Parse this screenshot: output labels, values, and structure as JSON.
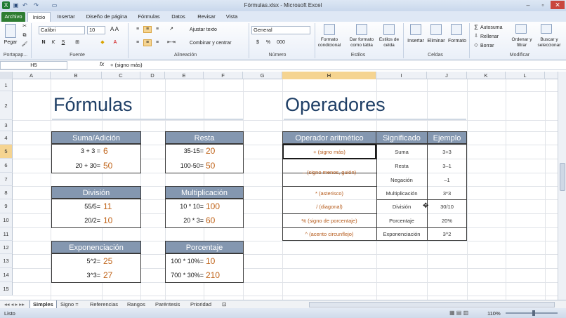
{
  "window": {
    "title": "Fórmulas.xlsx - Microsoft Excel"
  },
  "qat": {
    "save": "save-icon",
    "undo": "undo-icon",
    "redo": "redo-icon"
  },
  "tabs": [
    "Archivo",
    "Inicio",
    "Insertar",
    "Diseño de página",
    "Fórmulas",
    "Datos",
    "Revisar",
    "Vista"
  ],
  "ribbon": {
    "paste": "Pegar",
    "clipboard": "Portapap...",
    "font_name": "Calibri",
    "font_size": "10",
    "bold": "N",
    "italic": "K",
    "underline": "S",
    "font_group": "Fuente",
    "wrap": "Ajustar texto",
    "merge": "Combinar y centrar",
    "align_group": "Alineación",
    "number_format": "General",
    "currency": "$",
    "percent": "%",
    "thousands": "000",
    "number_group": "Número",
    "cond_format": "Formato condicional",
    "table_format": "Dar formato como tabla",
    "cell_styles": "Estilos de celda",
    "styles_group": "Estilos",
    "insert": "Insertar",
    "delete": "Eliminar",
    "format": "Formato",
    "cells_group": "Celdas",
    "autosum": "Autosuma",
    "fill": "Rellenar",
    "clear": "Borrar",
    "sort": "Ordenar y filtrar",
    "find": "Buscar y seleccionar",
    "modify_group": "Modificar"
  },
  "formula_bar": {
    "name_box": "H5",
    "fx": "fx",
    "content": "+ (signo más)"
  },
  "columns": [
    "A",
    "B",
    "C",
    "D",
    "E",
    "F",
    "G",
    "H",
    "I",
    "J",
    "K",
    "L"
  ],
  "rows": [
    "1",
    "2",
    "3",
    "4",
    "5",
    "6",
    "7",
    "8",
    "9",
    "10",
    "11",
    "12",
    "13",
    "14",
    "15"
  ],
  "sheet": {
    "formulas_title": "Fórmulas",
    "operators_title": "Operadores",
    "suma": {
      "header": "Suma/Adición",
      "rows": [
        {
          "label": "3 + 3 =",
          "value": "6"
        },
        {
          "label": "20 + 30=",
          "value": "50"
        }
      ]
    },
    "resta": {
      "header": "Resta",
      "rows": [
        {
          "label": "35-15=",
          "value": "20"
        },
        {
          "label": "100-50=",
          "value": "50"
        }
      ]
    },
    "division": {
      "header": "División",
      "rows": [
        {
          "label": "55/5=",
          "value": "11"
        },
        {
          "label": "20/2=",
          "value": "10"
        }
      ]
    },
    "multiplicacion": {
      "header": "Multiplicación",
      "rows": [
        {
          "label": "10 * 10=",
          "value": "100"
        },
        {
          "label": "20 * 3=",
          "value": "60"
        }
      ]
    },
    "exponenciacion": {
      "header": "Exponenciación",
      "rows": [
        {
          "label": "5^2=",
          "value": "25"
        },
        {
          "label": "3^3=",
          "value": "27"
        }
      ]
    },
    "porcentaje": {
      "header": "Porcentaje",
      "rows": [
        {
          "label": "100 * 10%=",
          "value": "10"
        },
        {
          "label": "700 * 30%=",
          "value": "210"
        }
      ]
    },
    "operators_table": {
      "headers": [
        "Operador aritmético",
        "Significado",
        "Ejemplo"
      ],
      "rows": [
        {
          "op": "+ (signo más)",
          "meaning": "Suma",
          "example": "3+3"
        },
        {
          "op": "",
          "meaning": "Resta",
          "example": "3–1"
        },
        {
          "op": "– (signo menos, guión)",
          "meaning": "Negación",
          "example": "–1"
        },
        {
          "op": "* (asterisco)",
          "meaning": "Multiplicación",
          "example": "3*3"
        },
        {
          "op": "/ (diagonal)",
          "meaning": "División",
          "example": "30/10"
        },
        {
          "op": "% (signo de porcentaje)",
          "meaning": "Porcentaje",
          "example": "20%"
        },
        {
          "op": "^ (acento circunflejo)",
          "meaning": "Exponenciación",
          "example": "3^2"
        }
      ]
    }
  },
  "sheet_tabs": [
    "Simples",
    "Signo =",
    "Referencias",
    "Rangos",
    "Paréntesis",
    "Prioridad"
  ],
  "status": {
    "ready": "Listo",
    "zoom": "110%"
  }
}
